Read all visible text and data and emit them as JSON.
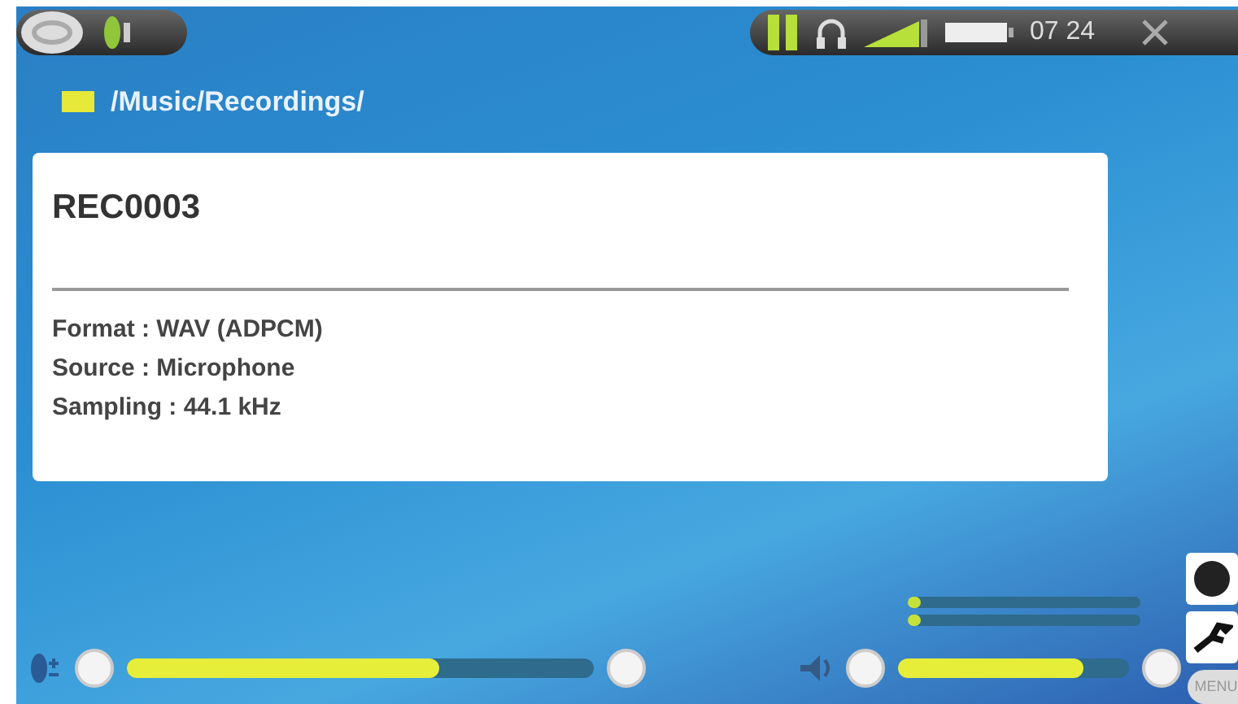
{
  "status_bar": {
    "time": "07 24"
  },
  "path": "/Music/Recordings/",
  "file": {
    "title": "REC0003",
    "details": [
      "Format : WAV (ADPCM)",
      "Source : Microphone",
      "Sampling : 44.1 kHz"
    ]
  },
  "meters": [
    {
      "level": 0.04
    },
    {
      "level": 0.04
    }
  ],
  "sliders": [
    {
      "kind": "input",
      "level": 0.67
    },
    {
      "kind": "volume",
      "level": 0.8
    }
  ],
  "menu_button": "MENU"
}
